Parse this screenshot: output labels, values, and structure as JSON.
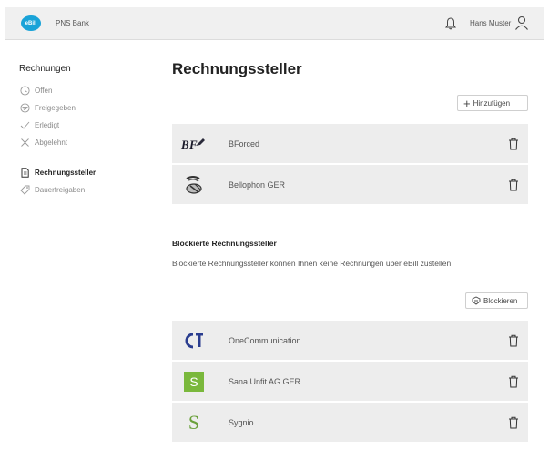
{
  "header": {
    "logo_text": "eBill",
    "bank_name": "PNS Bank",
    "user_name": "Hans Muster",
    "accent_color": "#1aa3d8"
  },
  "sidebar": {
    "heading": "Rechnungen",
    "items": [
      {
        "label": "Offen",
        "icon": "clock-icon"
      },
      {
        "label": "Freigegeben",
        "icon": "calendar-check-icon"
      },
      {
        "label": "Erledigt",
        "icon": "checkmark-icon"
      },
      {
        "label": "Abgelehnt",
        "icon": "x-icon"
      },
      {
        "label": "Rechnungssteller",
        "icon": "document-icon"
      },
      {
        "label": "Dauerfreigaben",
        "icon": "tag-icon"
      }
    ]
  },
  "main": {
    "title": "Rechnungssteller",
    "add_button": "Hinzufügen",
    "billers": [
      {
        "name": "BForced",
        "logo": "bforced-logo"
      },
      {
        "name": "Bellophon GER",
        "logo": "bellophon-logo"
      }
    ],
    "blocked_title": "Blockierte Rechnungssteller",
    "blocked_desc": "Blockierte Rechnungssteller können Ihnen keine Rechnungen über eBill zustellen.",
    "block_button": "Blockieren",
    "blocked": [
      {
        "name": "OneCommunication",
        "logo": "onecommunication-logo"
      },
      {
        "name": "Sana Unfit AG GER",
        "logo": "sana-logo",
        "logo_text": "S",
        "color": "#7ab83c"
      },
      {
        "name": "Sygnio",
        "logo": "sygnio-logo",
        "logo_text": "S",
        "color": "#6aa03a"
      }
    ]
  }
}
